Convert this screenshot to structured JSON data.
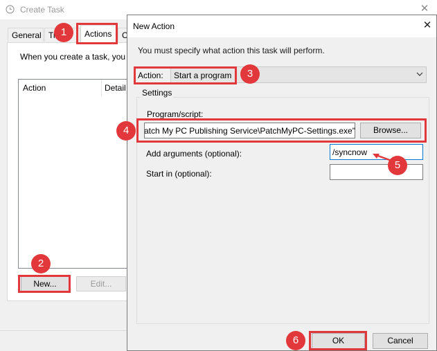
{
  "background_window": {
    "title": "Create Task",
    "close_glyph": "✕",
    "tabs": [
      {
        "label": "General"
      },
      {
        "label": "Tr"
      },
      {
        "label": "Actions"
      },
      {
        "label": "C"
      }
    ],
    "intro": "When you create a task, you m",
    "list_headers": {
      "action": "Action",
      "details": "Detail"
    },
    "new_button": "New...",
    "edit_button": "Edit..."
  },
  "dialog": {
    "title": "New Action",
    "close_glyph": "✕",
    "instruction": "You must specify what action this task will perform.",
    "action_label": "Action:",
    "action_value": "Start a program",
    "settings_label": "Settings",
    "program_label": "Program/script:",
    "program_value": "\"C:\\Program Files\\Patch My PC\\Patch My PC Publishing Service\\PatchMyPC-Settings.exe\"",
    "browse_button": "Browse...",
    "args_label": "Add arguments (optional):",
    "args_value": "/syncnow",
    "startin_label": "Start in (optional):",
    "startin_value": "",
    "ok_button": "OK",
    "cancel_button": "Cancel"
  },
  "annotations": {
    "badge_1": "1",
    "badge_2": "2",
    "badge_3": "3",
    "badge_4": "4",
    "badge_5": "5",
    "badge_6": "6",
    "highlight_color": "#e3383b"
  }
}
